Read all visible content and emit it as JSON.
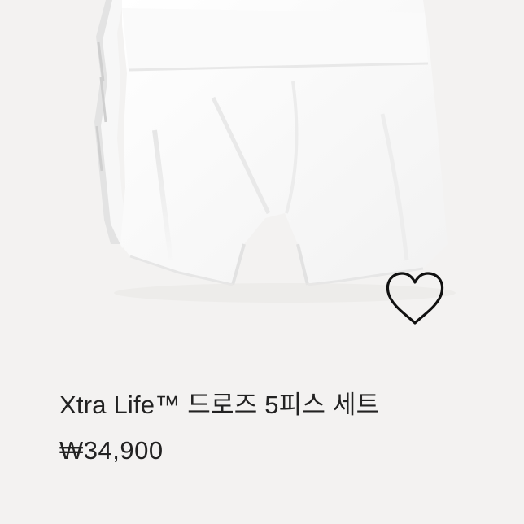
{
  "product": {
    "name": "Xtra Life™ 드로즈 5피스 세트",
    "price": "₩34,900"
  },
  "image": {
    "subject": "white boxer briefs stack"
  },
  "icons": {
    "wishlist": "heart-outline-icon"
  },
  "colors": {
    "background": "#f3f2f1",
    "text": "#222222",
    "icon_stroke": "#111111"
  }
}
